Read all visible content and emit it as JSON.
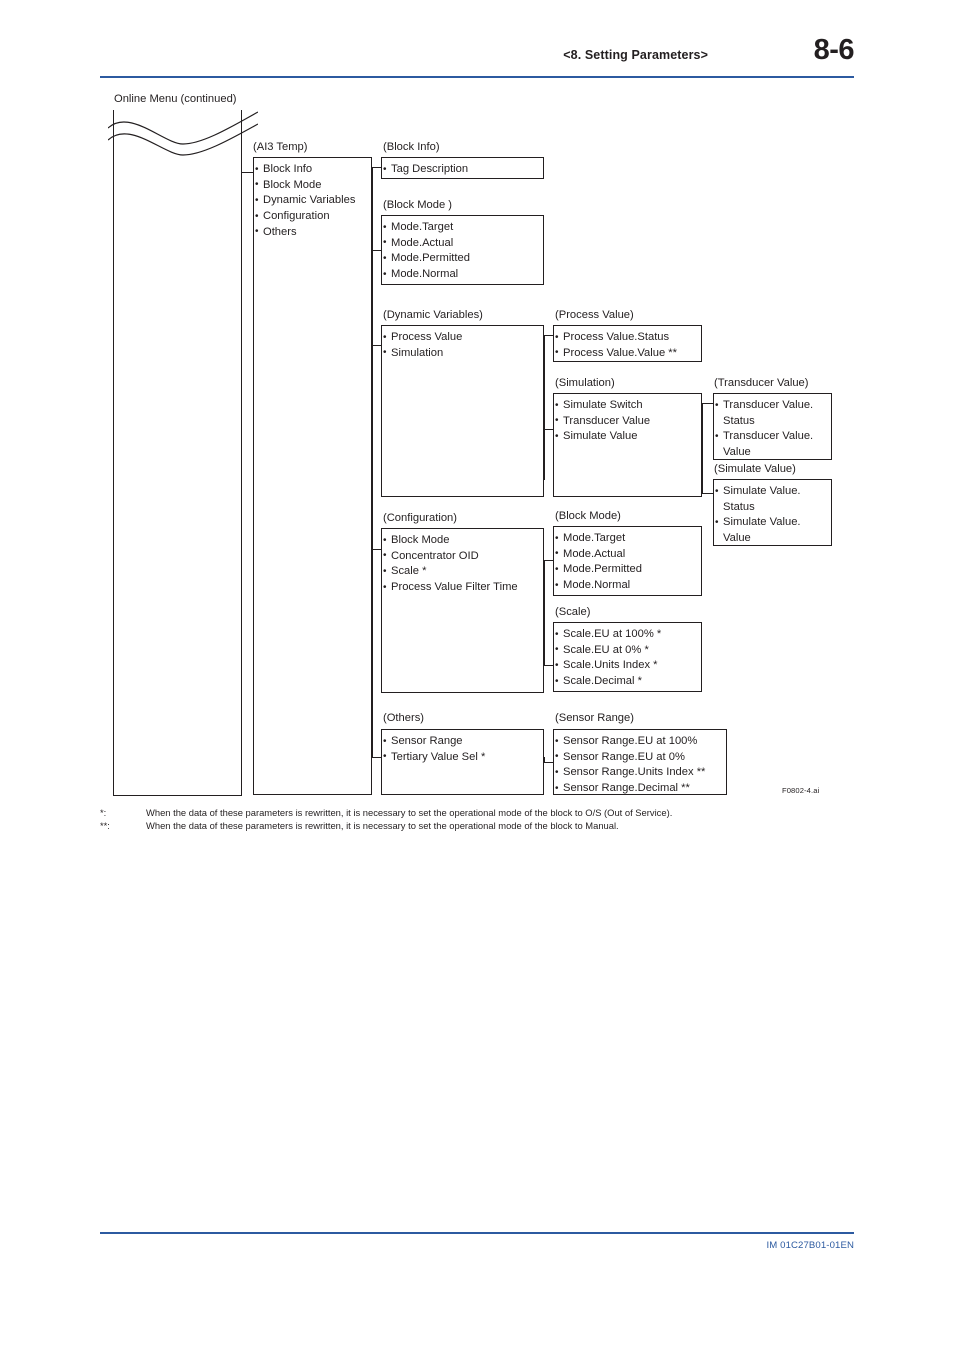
{
  "header": {
    "section_title": "<8.  Setting Parameters>",
    "page_number": "8-6"
  },
  "diagram": {
    "title": "Online Menu (continued)",
    "figure_id": "F0802-4.ai",
    "nodes": {
      "ai3_temp": {
        "caption": "(AI3 Temp)",
        "items": [
          "Block Info",
          "Block Mode",
          "Dynamic Variables",
          "Configuration",
          "Others"
        ]
      },
      "block_info": {
        "caption": "(Block Info)",
        "items": [
          "Tag Description"
        ]
      },
      "block_mode_1": {
        "caption": "(Block Mode )",
        "items": [
          "Mode.Target",
          "Mode.Actual",
          "Mode.Permitted",
          "Mode.Normal"
        ]
      },
      "dynamic_variables": {
        "caption": "(Dynamic Variables)",
        "items": [
          "Process Value",
          "Simulation"
        ]
      },
      "process_value": {
        "caption": "(Process Value)",
        "items": [
          "Process Value.Status",
          "Process Value.Value **"
        ]
      },
      "simulation": {
        "caption": "(Simulation)",
        "items": [
          "Simulate Switch",
          "Transducer Value",
          "Simulate Value"
        ]
      },
      "transducer_value": {
        "caption": "(Transducer Value)",
        "items": [
          {
            "line1": "Transducer Value.",
            "line2": "Status"
          },
          {
            "line1": "Transducer Value.",
            "line2": "Value"
          }
        ]
      },
      "simulate_value": {
        "caption": "(Simulate Value)",
        "items": [
          {
            "line1": "Simulate Value.",
            "line2": "Status"
          },
          {
            "line1": "Simulate Value.",
            "line2": "Value"
          }
        ]
      },
      "configuration": {
        "caption": "(Configuration)",
        "items": [
          "Block Mode",
          "Concentrator OID",
          "Scale *",
          "Process Value Filter Time"
        ]
      },
      "block_mode_2": {
        "caption": "(Block Mode)",
        "items": [
          "Mode.Target",
          "Mode.Actual",
          "Mode.Permitted",
          "Mode.Normal"
        ]
      },
      "scale": {
        "caption": "(Scale)",
        "items": [
          "Scale.EU at 100% *",
          "Scale.EU at 0% *",
          "Scale.Units Index *",
          "Scale.Decimal *"
        ]
      },
      "others": {
        "caption": "(Others)",
        "items": [
          "Sensor Range",
          "Tertiary Value Sel *"
        ]
      },
      "sensor_range": {
        "caption": "(Sensor Range)",
        "items": [
          "Sensor Range.EU at 100%",
          "Sensor Range.EU at 0%",
          "Sensor Range.Units Index **",
          "Sensor Range.Decimal **"
        ]
      }
    }
  },
  "footnotes": [
    {
      "mark": "*:",
      "text": "When the data of these parameters is rewritten, it is necessary to set the operational mode of the block to O/S (Out of Service)."
    },
    {
      "mark": "**:",
      "text": "When the data of these parameters is rewritten, it is necessary to set the operational mode of the block to Manual."
    }
  ],
  "footer": {
    "doc_id": "IM 01C27B01-01EN"
  },
  "colors": {
    "rule": "#2c5aa0",
    "ink": "#231f20"
  }
}
